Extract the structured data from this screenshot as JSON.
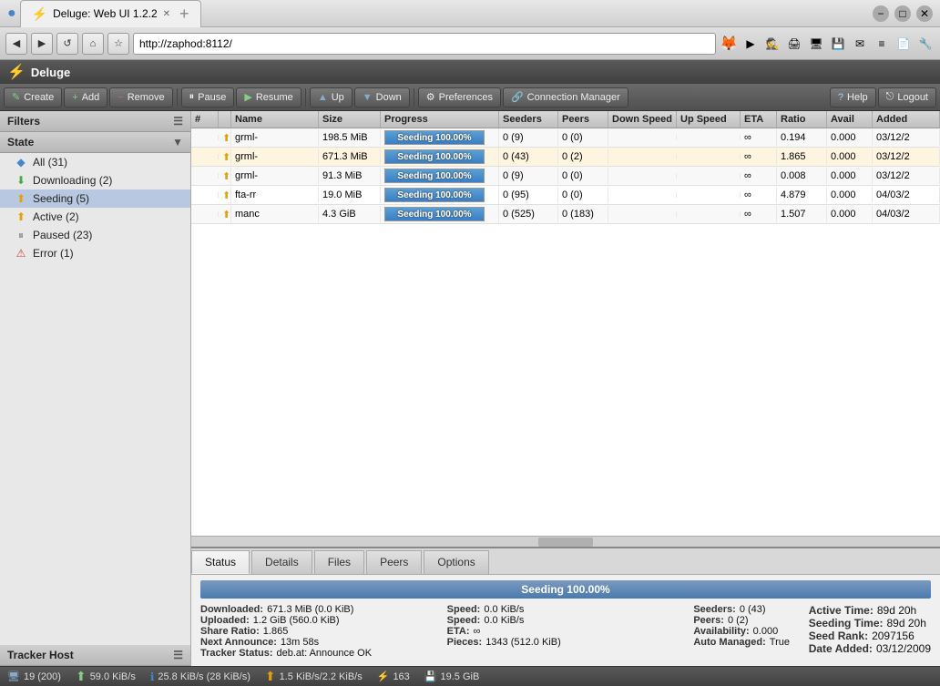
{
  "browser": {
    "title": "Deluge: Web UI 1.2.2 - Chromium",
    "tab_label": "Deluge: Web UI 1.2.2",
    "url": "http://zaphod:8112/"
  },
  "app": {
    "title": "Deluge",
    "toolbar": {
      "create": "Create",
      "add": "Add",
      "remove": "Remove",
      "pause": "Pause",
      "resume": "Resume",
      "up": "Up",
      "down": "Down",
      "preferences": "Preferences",
      "connection_manager": "Connection Manager",
      "help": "Help",
      "logout": "Logout"
    },
    "sidebar": {
      "filters_label": "Filters",
      "state_label": "State",
      "items": [
        {
          "label": "All (31)",
          "icon": "all",
          "active": false
        },
        {
          "label": "Downloading (2)",
          "icon": "dl",
          "active": false
        },
        {
          "label": "Seeding (5)",
          "icon": "seed",
          "active": true
        },
        {
          "label": "Active (2)",
          "icon": "active",
          "active": false
        },
        {
          "label": "Paused (23)",
          "icon": "pause",
          "active": false
        },
        {
          "label": "Error (1)",
          "icon": "error",
          "active": false
        }
      ],
      "tracker_host_label": "Tracker Host"
    },
    "table": {
      "columns": [
        "#",
        "Name",
        "Size",
        "Progress",
        "Seeders",
        "Peers",
        "Down Speed",
        "Up Speed",
        "ETA",
        "Ratio",
        "Avail",
        "Added"
      ],
      "col_widths": [
        "30px",
        "110px",
        "70px",
        "130px",
        "65px",
        "55px",
        "75px",
        "70px",
        "40px",
        "55px",
        "50px",
        "60px"
      ],
      "rows": [
        {
          "num": "",
          "icon": "seed",
          "name": "grml-",
          "size": "198.5 MiB",
          "progress": "Seeding 100.00%",
          "progress_pct": 100,
          "seeders": "0 (9)",
          "peers": "0 (0)",
          "down_speed": "",
          "up_speed": "",
          "eta": "∞",
          "ratio": "0.194",
          "avail": "0.000",
          "added": "03/12/2",
          "selected": false
        },
        {
          "num": "",
          "icon": "seed",
          "name": "grml-",
          "size": "671.3 MiB",
          "progress": "Seeding 100.00%",
          "progress_pct": 100,
          "seeders": "0 (43)",
          "peers": "0 (2)",
          "down_speed": "",
          "up_speed": "",
          "eta": "∞",
          "ratio": "1.865",
          "avail": "0.000",
          "added": "03/12/2",
          "selected": true
        },
        {
          "num": "",
          "icon": "seed",
          "name": "grml-",
          "size": "91.3 MiB",
          "progress": "Seeding 100.00%",
          "progress_pct": 100,
          "seeders": "0 (9)",
          "peers": "0 (0)",
          "down_speed": "",
          "up_speed": "",
          "eta": "∞",
          "ratio": "0.008",
          "avail": "0.000",
          "added": "03/12/2",
          "selected": false
        },
        {
          "num": "",
          "icon": "seed",
          "name": "fta-rr",
          "size": "19.0 MiB",
          "progress": "Seeding 100.00%",
          "progress_pct": 100,
          "seeders": "0 (95)",
          "peers": "0 (0)",
          "down_speed": "",
          "up_speed": "",
          "eta": "∞",
          "ratio": "4.879",
          "avail": "0.000",
          "added": "04/03/2",
          "selected": false
        },
        {
          "num": "",
          "icon": "seed",
          "name": "manc",
          "size": "4.3 GiB",
          "progress": "Seeding 100.00%",
          "progress_pct": 100,
          "seeders": "0 (525)",
          "peers": "0 (183)",
          "down_speed": "",
          "up_speed": "",
          "eta": "∞",
          "ratio": "1.507",
          "avail": "0.000",
          "added": "04/03/2",
          "selected": false
        }
      ]
    },
    "detail": {
      "tabs": [
        "Status",
        "Details",
        "Files",
        "Peers",
        "Options"
      ],
      "active_tab": "Status",
      "status_text": "Seeding 100.00%",
      "fields": {
        "downloaded_label": "Downloaded:",
        "downloaded_value": "671.3 MiB (0.0 KiB)",
        "speed1_label": "Speed:",
        "speed1_value": "0.0 KiB/s",
        "seeders_label": "Seeders:",
        "seeders_value": "0 (43)",
        "active_time_label": "Active Time:",
        "active_time_value": "89d 20h",
        "uploaded_label": "Uploaded:",
        "uploaded_value": "1.2 GiB (560.0 KiB)",
        "speed2_label": "Speed:",
        "speed2_value": "0.0 KiB/s",
        "peers_label": "Peers:",
        "peers_value": "0 (2)",
        "seeding_time_label": "Seeding Time:",
        "seeding_time_value": "89d 20h",
        "share_ratio_label": "Share Ratio:",
        "share_ratio_value": "1.865",
        "eta_label": "ETA:",
        "eta_value": "∞",
        "availability_label": "Availability:",
        "availability_value": "0.000",
        "seed_rank_label": "Seed Rank:",
        "seed_rank_value": "2097156",
        "next_announce_label": "Next Announce:",
        "next_announce_value": "13m 58s",
        "pieces_label": "Pieces:",
        "pieces_value": "1343 (512.0 KiB)",
        "auto_managed_label": "Auto Managed:",
        "auto_managed_value": "True",
        "date_added_label": "Date Added:",
        "date_added_value": "03/12/2009",
        "tracker_status_label": "Tracker Status:",
        "tracker_status_value": "deb.at: Announce OK"
      }
    },
    "statusbar": {
      "connections": "19 (200)",
      "down_speed": "59.0 KiB/s",
      "up_speed": "25.8 KiB/s (28 KiB/s)",
      "upload2": "1.5 KiB/s/2.2 KiB/s",
      "count": "163",
      "storage": "19.5 GiB"
    }
  }
}
